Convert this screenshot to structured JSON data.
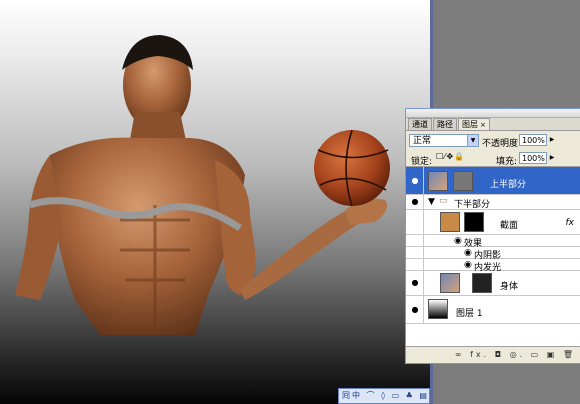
{
  "panel": {
    "tabs": [
      {
        "label": "通道"
      },
      {
        "label": "路径"
      },
      {
        "label": "图层",
        "close": "×"
      }
    ],
    "blend_mode": "正常",
    "opacity_label": "不透明度:",
    "opacity_value": "100%",
    "lock_label": "锁定:",
    "lock_icons": "☐⁄✥🔒",
    "fill_label": "填充:",
    "fill_value": "100%",
    "dropdown_arrow": "▼",
    "small_arrow": "▶",
    "layers": [
      {
        "name": "上半部分"
      },
      {
        "name": "下半部分"
      },
      {
        "name": "截面",
        "fx": "fx"
      },
      {
        "name": "效果"
      },
      {
        "name": "内阴影"
      },
      {
        "name": "内发光"
      },
      {
        "name": "身体"
      },
      {
        "name": "图层 1"
      }
    ],
    "bottom_icons": "∞ fx. ◘ ◎. ▭ ▣ 🗑"
  },
  "taskbar": {
    "text": "囘中 ⌒ ◊ ▭ ♣ ▤"
  },
  "colors": {
    "selection": "#3166c8",
    "panel_bg": "#ece9d8",
    "workspace": "#7c7c7c"
  }
}
